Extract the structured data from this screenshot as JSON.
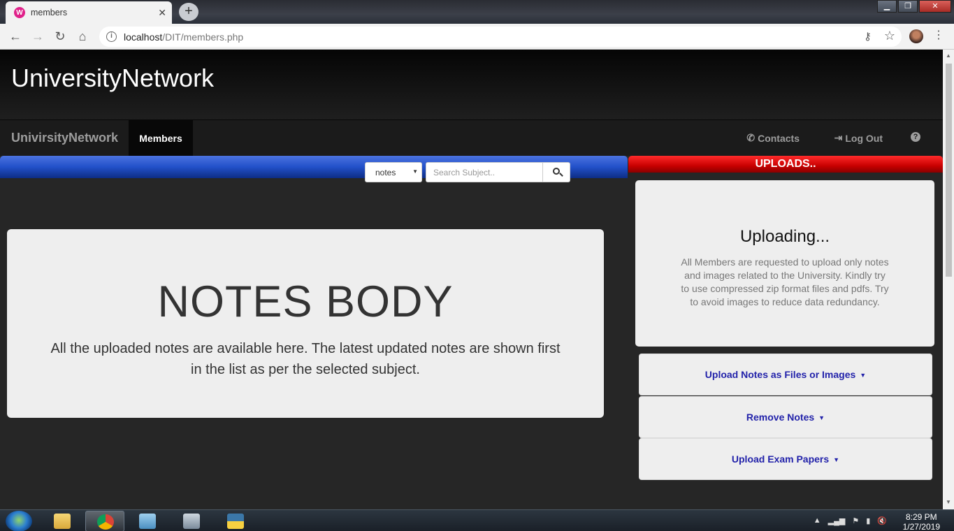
{
  "browser": {
    "tab_title": "members",
    "url_host": "localhost",
    "url_path": "/DIT/members.php"
  },
  "site": {
    "title": "UniversityNetwork",
    "brand": "UnivirsityNetwork",
    "nav_active": "Members",
    "nav_right": [
      "Contacts",
      "Log Out"
    ]
  },
  "search": {
    "select_value": "notes",
    "placeholder": "Search Subject.."
  },
  "notes": {
    "heading": "NOTES BODY",
    "description": "All the uploaded notes are available here. The latest updated notes are shown first in the list as per the selected subject."
  },
  "uploads": {
    "bar_title": "UPLOADS..",
    "card_title": "Uploading...",
    "card_text": "All Members are requested to upload only notes and images related to the University. Kindly try to use compressed zip format files and pdfs. Try to avoid images to reduce data redundancy.",
    "panels": [
      "Upload Notes as Files or Images",
      "Remove Notes",
      "Upload Exam Papers"
    ]
  },
  "taskbar": {
    "time": "8:29 PM",
    "date": "1/27/2019"
  },
  "colors": {
    "accent_blue": "#2250c9",
    "accent_red": "#c80000",
    "link_blue": "#2222aa"
  }
}
